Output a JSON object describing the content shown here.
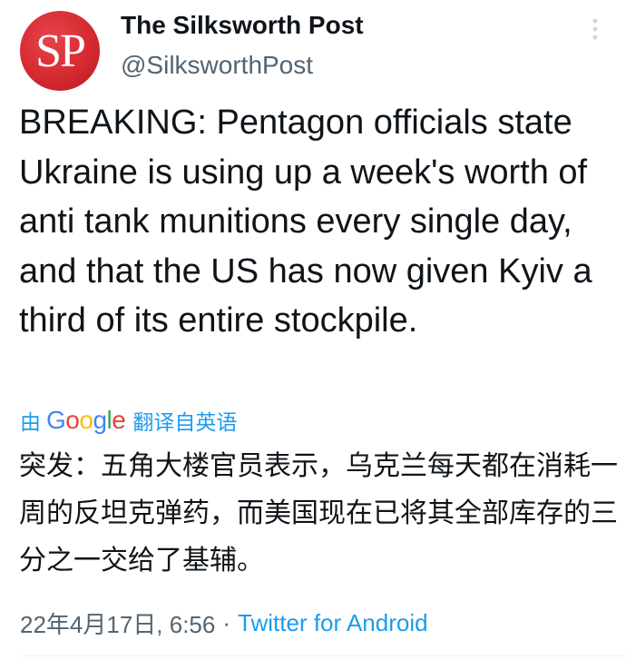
{
  "account": {
    "avatar_text": "SP",
    "display_name": "The Silksworth Post",
    "handle": "@SilksworthPost"
  },
  "tweet": {
    "text": "BREAKING: Pentagon officials state Ukraine is using up a week's worth of anti tank munitions every single day, and that the US has now given Kyiv a third of its entire stockpile.",
    "translation": {
      "by_label": "由",
      "provider_letters": [
        "G",
        "o",
        "o",
        "g",
        "l",
        "e"
      ],
      "action_label": "翻译自英语",
      "text": "突发：五角大楼官员表示，乌克兰每天都在消耗一周的反坦克弹药，而美国现在已将其全部库存的三分之一交给了基辅。"
    },
    "timestamp": "22年4月17日, 6:56",
    "separator": "·",
    "source": "Twitter for Android"
  },
  "icons": {
    "more": "more-vertical-icon"
  },
  "colors": {
    "avatar_bg": "#d52a31",
    "link_blue": "#1d9bf0",
    "secondary_text": "#536471",
    "primary_text": "#0f1419"
  }
}
